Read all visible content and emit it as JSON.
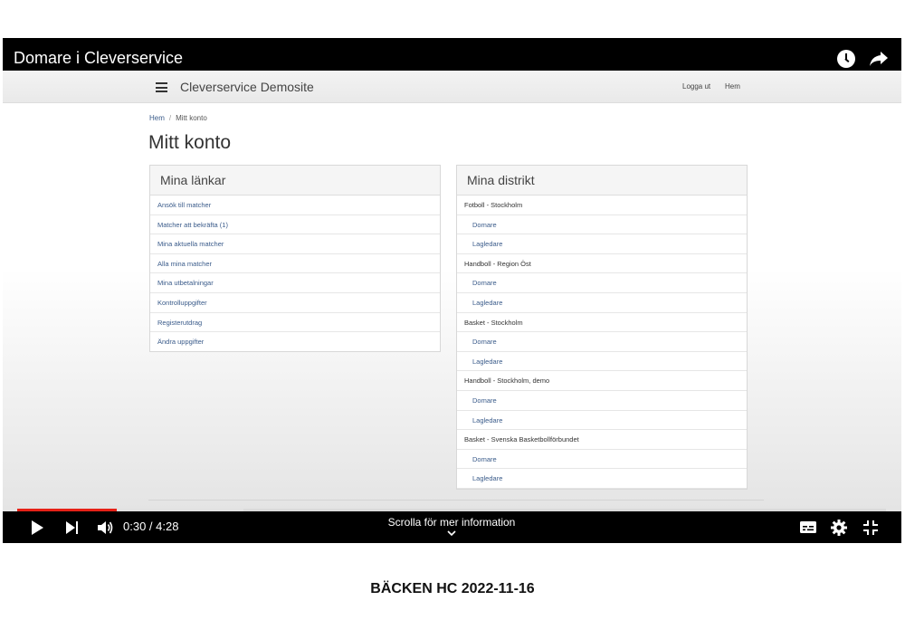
{
  "player": {
    "title": "Domare i Cleverservice",
    "time_current": "0:30",
    "time_total": "4:28",
    "time_display": "0:30 / 4:28",
    "scroll_hint": "Scrolla för mer information",
    "progress_played_fraction": 0.115,
    "progress_buffered_fraction": 0.26,
    "colors": {
      "progress": "#e62117",
      "bar": "#000000"
    },
    "icons": [
      "clock-icon",
      "share-icon",
      "play-icon",
      "next-icon",
      "volume-icon",
      "chevron-down-icon",
      "captions-icon",
      "gear-icon",
      "exit-fullscreen-icon"
    ]
  },
  "site": {
    "title": "Cleverservice Demosite",
    "nav": {
      "logout": "Logga ut",
      "home": "Hem"
    },
    "breadcrumb": {
      "home": "Hem",
      "separator": "/",
      "current": "Mitt konto"
    },
    "page_title": "Mitt konto",
    "links_panel": {
      "heading": "Mina länkar",
      "items": [
        "Ansök till matcher",
        "Matcher att bekräfta (1)",
        "Mina aktuella matcher",
        "Alla mina matcher",
        "Mina utbetalningar",
        "Kontrolluppgifter",
        "Registerutdrag",
        "Ändra uppgifter"
      ]
    },
    "districts_panel": {
      "heading": "Mina distrikt",
      "districts": [
        {
          "name": "Fotboll - Stockholm",
          "roles": [
            "Domare",
            "Lagledare"
          ]
        },
        {
          "name": "Handboll - Region Öst",
          "roles": [
            "Domare",
            "Lagledare"
          ]
        },
        {
          "name": "Basket - Stockholm",
          "roles": [
            "Domare",
            "Lagledare"
          ]
        },
        {
          "name": "Handboll - Stockholm, demo",
          "roles": [
            "Domare",
            "Lagledare"
          ]
        },
        {
          "name": "Basket - Svenska Basketbollförbundet",
          "roles": [
            "Domare",
            "Lagledare"
          ]
        }
      ]
    }
  },
  "caption": "BÄCKEN HC 2022-11-16"
}
